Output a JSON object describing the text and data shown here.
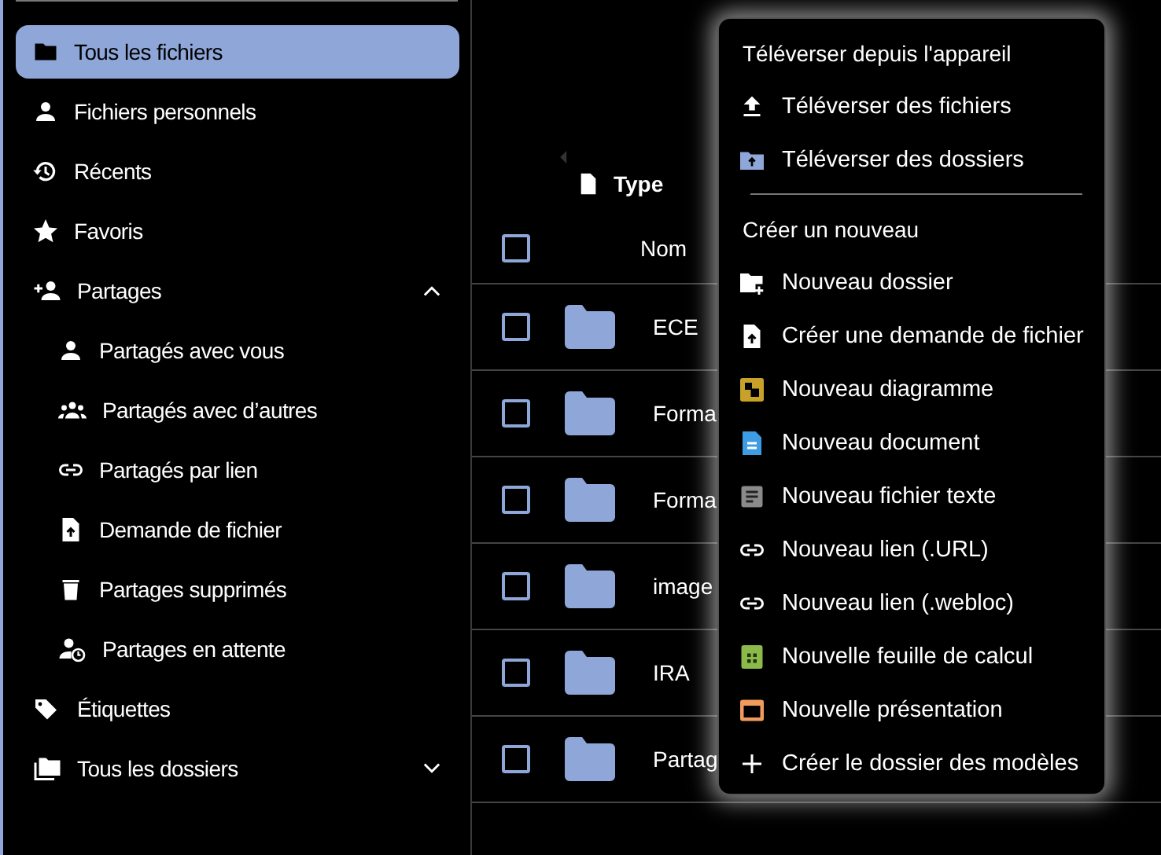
{
  "sidebar": {
    "items": [
      {
        "label": "Tous les fichiers",
        "selected": true
      },
      {
        "label": "Fichiers personnels",
        "selected": false
      },
      {
        "label": "Récents",
        "selected": false
      },
      {
        "label": "Favoris",
        "selected": false
      },
      {
        "label": "Partages",
        "selected": false,
        "expanded": true,
        "children": [
          {
            "label": "Partagés avec vous",
            "selected": false
          },
          {
            "label": "Partagés avec d’autres",
            "selected": false
          },
          {
            "label": "Partagés par lien",
            "selected": false
          },
          {
            "label": "Demande de fichier",
            "selected": false
          },
          {
            "label": "Partages supprimés",
            "selected": false
          },
          {
            "label": "Partages en attente",
            "selected": false
          }
        ]
      },
      {
        "label": "Étiquettes",
        "selected": false
      },
      {
        "label": "Tous les dossiers",
        "selected": false,
        "expanded": false
      }
    ]
  },
  "files": {
    "filter": "Type",
    "select_all": {
      "checked": false
    },
    "columns": [
      "Nom"
    ],
    "rows": [
      {
        "name": "ECE",
        "checked": false
      },
      {
        "name": "Forma",
        "checked": false
      },
      {
        "name": "Forma",
        "checked": false
      },
      {
        "name": "image",
        "checked": false
      },
      {
        "name": "IRA",
        "checked": false
      },
      {
        "name": "Partag",
        "checked": false
      }
    ]
  },
  "menu": {
    "sections": [
      {
        "title": "Téléverser depuis l'appareil",
        "items": [
          {
            "label": "Téléverser des fichiers"
          },
          {
            "label": "Téléverser des dossiers"
          }
        ]
      },
      {
        "title": "Créer un nouveau",
        "items": [
          {
            "label": "Nouveau dossier"
          },
          {
            "label": "Créer une demande de fichier"
          },
          {
            "label": "Nouveau diagramme"
          },
          {
            "label": "Nouveau document"
          },
          {
            "label": "Nouveau fichier texte"
          },
          {
            "label": "Nouveau lien (.URL)"
          },
          {
            "label": "Nouveau lien (.webloc)"
          },
          {
            "label": "Nouvelle feuille de calcul"
          },
          {
            "label": "Nouvelle présentation"
          },
          {
            "label": "Créer le dossier des modèles"
          }
        ]
      }
    ]
  }
}
